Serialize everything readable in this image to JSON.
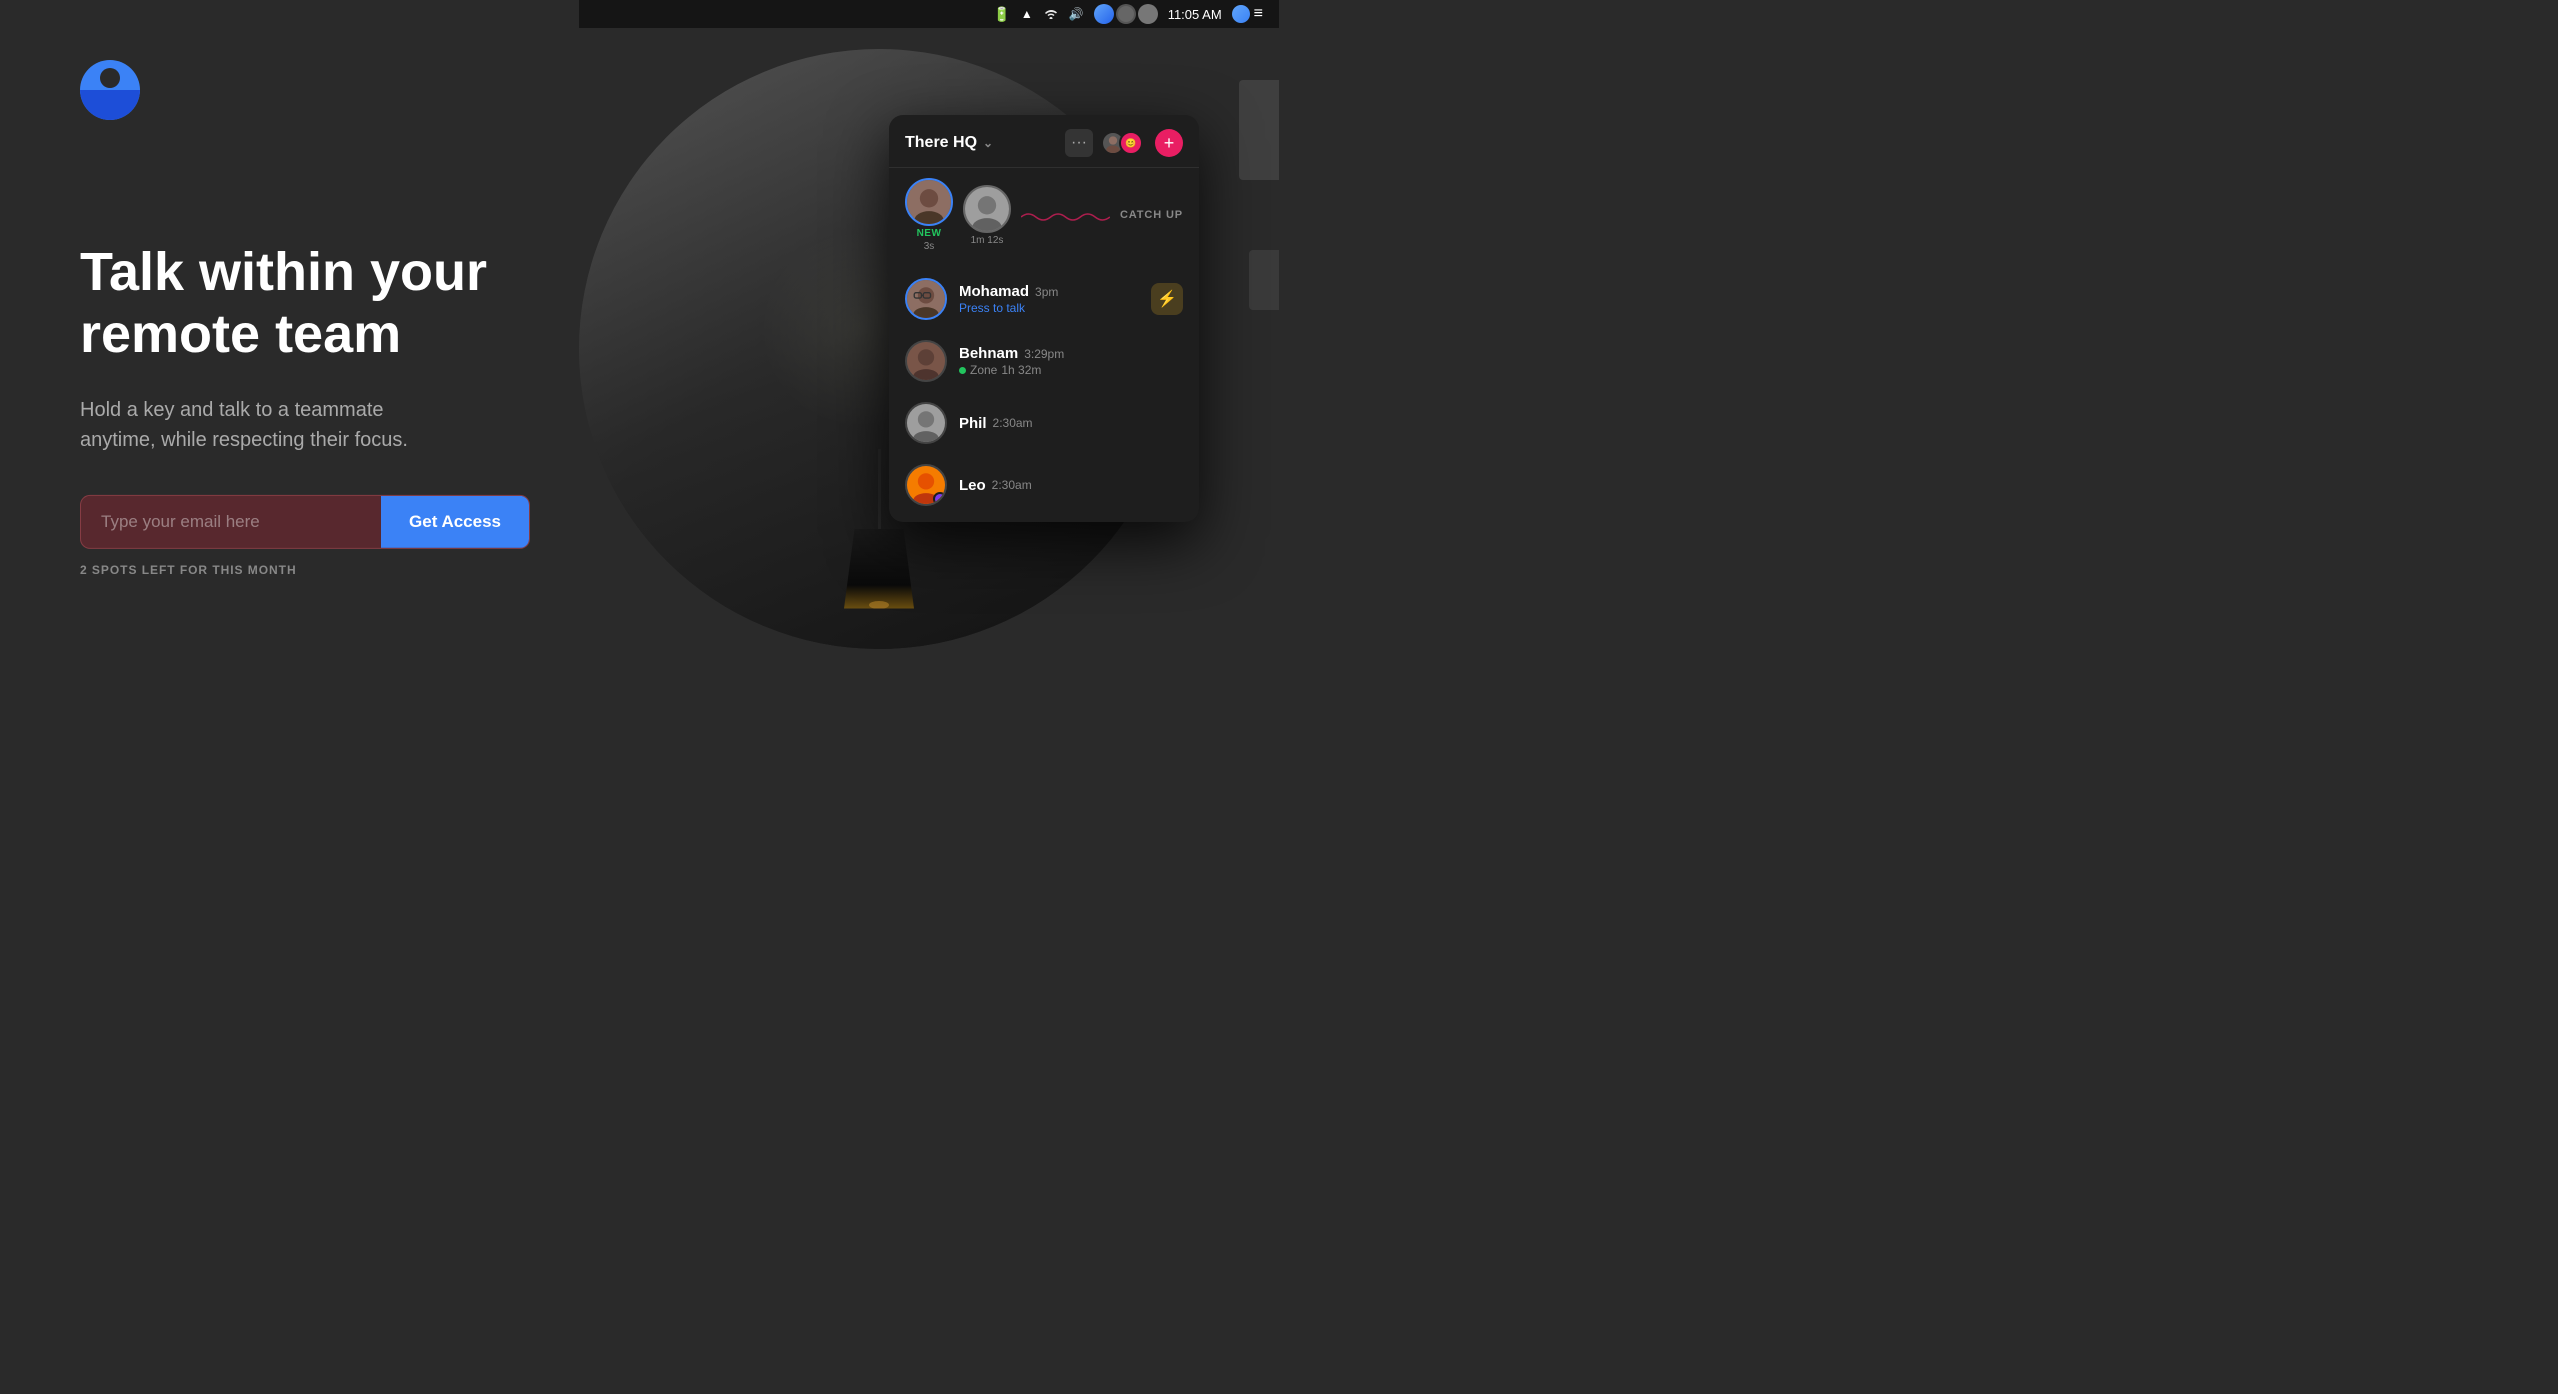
{
  "app": {
    "title": "There HQ",
    "logo_alt": "There app logo"
  },
  "menubar": {
    "time": "11:05 AM",
    "icons": [
      "battery",
      "volume",
      "wifi",
      "sound"
    ]
  },
  "hero": {
    "heading_line1": "Talk within your",
    "heading_line2": "remote team",
    "subheading": "Hold a key and talk to a teammate\nanytime, while respecting their focus.",
    "email_placeholder": "Type your email here",
    "cta_label": "Get Access",
    "spots_text": "2 SPOTS LEFT FOR THIS MONTH"
  },
  "popup": {
    "title": "There HQ",
    "catch_up_label": "CATCH UP",
    "status_new_label": "NEW",
    "status_new_time": "3s",
    "status_second_time": "1m 12s",
    "members": [
      {
        "name": "Mohamad",
        "time": "3pm",
        "status": "Press to talk",
        "has_ring": true,
        "action_icon": "⚡"
      },
      {
        "name": "Behnam",
        "time": "3:29pm",
        "status_zone": "Zone",
        "status_zone_time": "1h 32m",
        "has_ring": false,
        "action_icon": null
      },
      {
        "name": "Phil",
        "time": "2:30am",
        "status": null,
        "has_ring": false,
        "action_icon": null
      },
      {
        "name": "Leo",
        "time": "2:30am",
        "status": null,
        "has_ring": false,
        "action_icon": null
      }
    ]
  },
  "colors": {
    "accent_blue": "#3b82f6",
    "accent_pink": "#e91e63",
    "accent_green": "#22c55e",
    "background": "#2a2a2a",
    "popup_bg": "#1e1e1e"
  }
}
